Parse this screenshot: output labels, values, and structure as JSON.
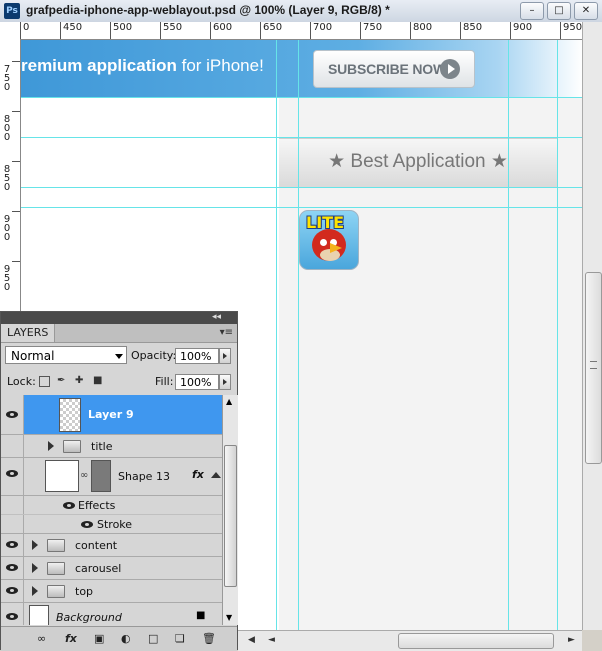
{
  "window": {
    "app_icon": "Ps",
    "title": "grafpedia-iphone-app-weblayout.psd @ 100% (Layer 9, RGB/8) *",
    "minimize": "–",
    "maximize": "□",
    "close": "✕"
  },
  "ruler": {
    "h_labels": [
      "0",
      "450",
      "500",
      "550",
      "600",
      "650",
      "700",
      "750",
      "800",
      "850",
      "900",
      "950"
    ],
    "v_labels": [
      "750",
      "800",
      "850",
      "900",
      "950"
    ]
  },
  "canvas": {
    "banner_bold": "remium application",
    "banner_rest": " for iPhone!",
    "subscribe_label": "SUBSCRIBE NOW",
    "best_title": "★ Best Application ★",
    "app_icon_badge": "LITE"
  },
  "layers_panel": {
    "collapse_icon": "◂◂",
    "tab_label": "LAYERS",
    "menu_icon": "▾≡",
    "blend_mode": "Normal",
    "opacity_label": "Opacity:",
    "opacity_value": "100%",
    "lock_label": "Lock:",
    "fill_label": "Fill:",
    "fill_value": "100%",
    "layers": {
      "layer9": "Layer 9",
      "title": "title",
      "shape13": "Shape 13",
      "effects": "Effects",
      "stroke": "Stroke",
      "content": "content",
      "carousel": "carousel",
      "top": "top",
      "background": "Background"
    },
    "fx_label": "fx",
    "bottom_icons": [
      "link-icon",
      "fx-icon",
      "mask-icon",
      "adjustment-icon",
      "group-icon",
      "new-layer-icon",
      "trash-icon"
    ]
  },
  "colors": {
    "banner_blue": "#3f98d8",
    "selected_layer": "#3f97ef",
    "guide_cyan": "#66e4e8"
  }
}
